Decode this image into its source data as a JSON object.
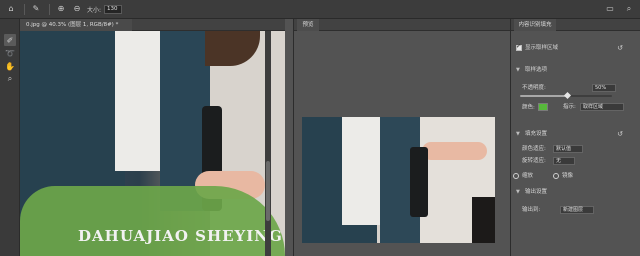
{
  "topbar": {
    "zoom_label": "大小:",
    "zoom_value": "130"
  },
  "document": {
    "tab_title": "0.jpg @ 40.3% (图层 1, RGB/8#) *"
  },
  "canvas": {
    "watermark_text": "DAHUAJIAO SHEYING",
    "mask_color": "#6da64a"
  },
  "preview": {
    "tab_label": "预览"
  },
  "settings": {
    "tab_label": "内容识别填充",
    "show_sampling_area": "显示取样区域",
    "sampling_options_header": "取样选项",
    "opacity_label": "不透明度:",
    "opacity_value": "50%",
    "color_label": "颜色:",
    "color_swatch": "#57b83b",
    "indicates_label": "指示:",
    "indicates_value": "取样区域",
    "fill_settings_header": "填充设置",
    "color_adapt_label": "颜色适应:",
    "color_adapt_value": "默认值",
    "rotation_adapt_label": "旋转适应:",
    "rotation_adapt_value": "无",
    "scale_label": "缩放",
    "mirror_label": "镜像",
    "output_settings_header": "输出设置",
    "output_to_label": "输出到:",
    "output_to_value": "新建图层"
  }
}
